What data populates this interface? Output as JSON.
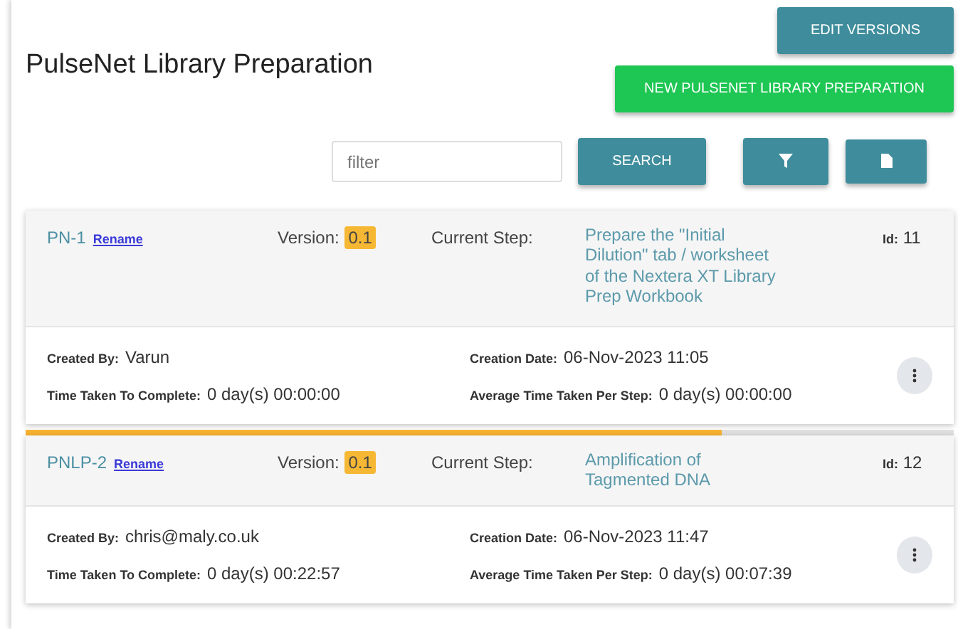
{
  "title": "PulseNet Library Preparation",
  "buttons": {
    "edit_versions": "EDIT VERSIONS",
    "new": "NEW PULSENET LIBRARY PREPARATION",
    "search": "SEARCH"
  },
  "filter": {
    "placeholder": "filter"
  },
  "cards": [
    {
      "name": "PN-1",
      "rename": "Rename",
      "version_label": "Version:",
      "version": "0.1",
      "step_label": "Current Step:",
      "step": "Prepare the \"Initial Dilution\" tab / worksheet of the Nextera XT Library Prep Workbook",
      "id_label": "Id:",
      "id": "11",
      "details": [
        {
          "label": "Created By:",
          "value": "Varun"
        },
        {
          "label": "Creation Date:",
          "value": "06-Nov-2023 11:05"
        },
        {
          "label": "Time Taken To Complete:",
          "value": "0 day(s) 00:00:00"
        },
        {
          "label": "Average Time Taken Per Step:",
          "value": "0 day(s) 00:00:00"
        }
      ]
    },
    {
      "name": "PNLP-2",
      "rename": "Rename",
      "level": 0.75,
      "version_label": "Version:",
      "version": "0.1",
      "step_label": "Current Step:",
      "step": "Amplification of Tagmented DNA",
      "id_label": "Id:",
      "id": "12",
      "details": [
        {
          "label": "Created By:",
          "value": "chris@maly.co.uk"
        },
        {
          "label": "Creation Date:",
          "value": "06-Nov-2023 11:47"
        },
        {
          "label": "Time Taken To Complete:",
          "value": "0 day(s) 00:22:57"
        },
        {
          "label": "Average Time Taken Per Step:",
          "value": "0 day(s) 00:07:39"
        }
      ]
    }
  ]
}
